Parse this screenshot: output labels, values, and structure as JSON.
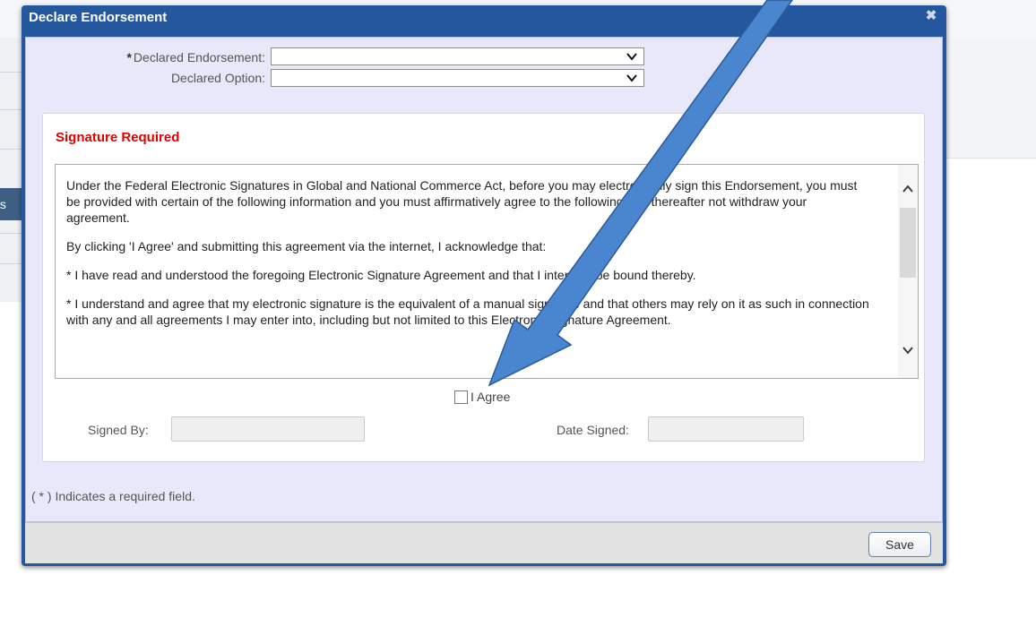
{
  "dialog": {
    "title": "Declare Endorsement",
    "close_icon": "close-icon",
    "fields": {
      "declared_endorsement": {
        "label": "Declared Endorsement:",
        "required_mark": "*",
        "value": ""
      },
      "declared_option": {
        "label": "Declared Option:",
        "value": ""
      }
    },
    "signature": {
      "title": "Signature Required",
      "paragraphs": [
        "Under the Federal Electronic Signatures in Global and National Commerce Act, before you may electronically sign this Endorsement, you must be provided with certain of the following information and you must affirmatively agree to the following and thereafter not withdraw your agreement.",
        "By clicking 'I Agree' and submitting this agreement via the internet, I acknowledge that:",
        "* I have read and understood the foregoing Electronic Signature Agreement and that I intend to be bound thereby.",
        "* I understand and agree that my electronic signature is the equivalent of a manual signature and that others may rely on it as such in connection with any and all agreements I may enter into, including but not limited to this Electronic Signature Agreement."
      ],
      "agree_label": "I Agree",
      "agree_checked": false,
      "signed_by_label": "Signed By:",
      "signed_by_value": "",
      "date_signed_label": "Date Signed:",
      "date_signed_value": ""
    },
    "required_note": "( * ) Indicates a required field.",
    "save_label": "Save"
  },
  "background": {
    "left_tab_text": "ts"
  },
  "colors": {
    "title_bar": "#25579e",
    "body_bg": "#e8e8fa",
    "signature_title": "#e00000",
    "annotation_arrow": "#4a86d0"
  }
}
